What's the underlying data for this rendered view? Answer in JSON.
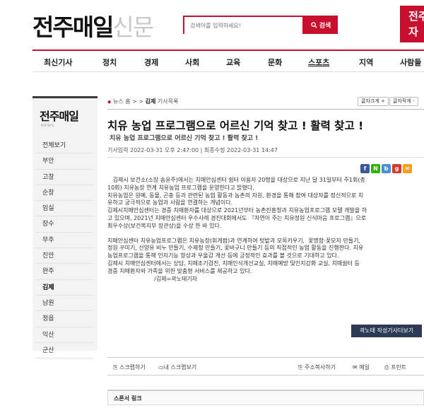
{
  "header": {
    "logo_main": "전주매일",
    "logo_sub": "신문",
    "search_placeholder": "검색어를 입력하세요!",
    "search_button": "검색",
    "banner_line1": "전주",
    "banner_line2": "자"
  },
  "nav": [
    "최신기사",
    "정치",
    "경제",
    "사회",
    "교육",
    "문화",
    "스포츠",
    "지역",
    "사람들"
  ],
  "sidebar": {
    "logo": "전주매일",
    "logo_sub": "NEWS",
    "items": [
      "전체보기",
      "부안",
      "고창",
      "순창",
      "임실",
      "장수",
      "무주",
      "진안",
      "완주",
      "김제",
      "남원",
      "정읍",
      "익산",
      "군산"
    ],
    "active_index": 9
  },
  "breadcrumb": {
    "home": "뉴스 홈",
    "sep": ">",
    "current": "김제",
    "suffix": "기사목록"
  },
  "font_controls": {
    "larger": "글자크게 +",
    "smaller": "글자작게 -"
  },
  "article": {
    "title": "치유 농업 프로그램으로 어르신 기억 찾고 ! 활력 찾고 !",
    "subtitle": "치유 농업 프로그램으로 어르신 기억 찾고 ! 활력 찾고 !",
    "dates": "기사입력 2022-03-31 오후 2:47:00 | 최종수정 2022-03-31 14:47",
    "share_icons": [
      {
        "name": "facebook-icon",
        "glyph": "f",
        "color": "#3b5998"
      },
      {
        "name": "naver-icon",
        "glyph": "N",
        "color": "#2db400"
      },
      {
        "name": "band-icon",
        "glyph": "b",
        "color": "#4a8ed6"
      },
      {
        "name": "google-icon",
        "glyph": "g",
        "color": "#d23b2e"
      },
      {
        "name": "mail-icon",
        "glyph": "✉",
        "color": "#f0a020"
      }
    ],
    "paragraphs": [
      [
        "   김제시 보건소(소장 송윤주)에서는 치매안심센터 쉼터 이용자 20명을 대상으로 지난 달 31일부터 주1회(총",
        "10회) 치유농장 연계 치유농업 프로그램을 운영한다고 밝혔다."
      ],
      [
        "치유농업은 원예, 동물, 곤충 등과 관련된 농업 활동과 농촌의 자원, 환경을 통해 참여 대상자를 정신적으로 치",
        "유하고 궁극적으로 농업과 사람을 연결하는 개념이다."
      ],
      [
        "김제시치매안심센터는 경증 치매환자를 대상으로 2021년부터 농촌진흥청과 치유농업프로그램 모델 개발을 하",
        "고 있으며, 2021년 치매안심센터 우수사례 경진대회에서도 『자연이 주는 치유정원 신식마음 프로그램』으로",
        "최우수상(보건복지부 장관상)을 수상 한 바 있다."
      ],
      [],
      [
        "치매안심센터 치유농업프로그램은 치유농장(휘게팜)과 연계하여 텃밭과 모목키우기,  꽃명함·꽃모자 만들기,",
        "정원 꾸미기, 산양유 비누 만들기, 수제청 만들기, 꽃바구니 만들기 등의 직접적인 농업 활동을 진행한다. 치유",
        "농업프로그램을 통해 인지기능 향상과 우울감 개선 등에 긍정적인 효과를 볼 것으로 기대하고 있다."
      ],
      [
        "김제시 치매안심센터에서는 상담, 치매조기검진, 치매인식개선교실, 치매예방 및인지강화 교실, 치매쉼터 등",
        "경증 치매환자와 가족을 위한 맞춤형 서비스를 제공하고 있다."
      ],
      [
        "                          /김제=곽노태기자"
      ]
    ],
    "journalist_button": "곽노태 작성기사더보기"
  },
  "toolbar": {
    "scrap": "스크랩하기",
    "my_scrap": "내 스크랩보기",
    "copy_url": "주소복사하기",
    "email": "메일",
    "print": "프린트"
  },
  "sponsor": {
    "label": "스폰서 링크"
  }
}
